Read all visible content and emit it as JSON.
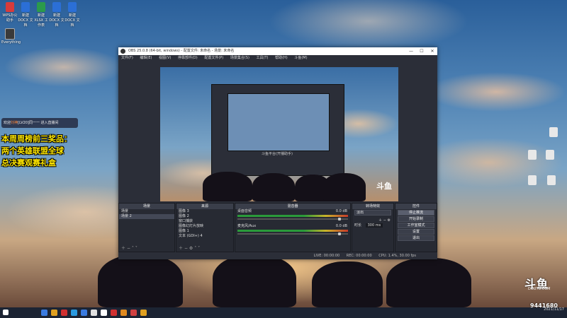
{
  "desktop": {
    "left_icons": [
      {
        "label": "WPS办公助手",
        "color": "#d83b3b"
      },
      {
        "label": "新建 DOCX 文档",
        "color": "#2b6fd6"
      },
      {
        "label": "新建 XLSX 工作表",
        "color": "#2b9a4c"
      },
      {
        "label": "新建 DOCX 文档",
        "color": "#2b6fd6"
      },
      {
        "label": "新建 DOCX 文档",
        "color": "#2b6fd6"
      }
    ],
    "recycle_label": "Everything",
    "right_icons": [
      {
        "label": "",
        "color": "#e8e8e8"
      },
      {
        "label": "",
        "color": "#e8e8e8"
      },
      {
        "label": "",
        "color": "#e8e8e8"
      },
      {
        "label": "",
        "color": "#e8e8e8"
      },
      {
        "label": "",
        "color": "#e8e8e8"
      }
    ],
    "notice_text": "欢迎",
    "notice_user": "刘神",
    "notice_rest": "[LV20]同一一 进入直播间",
    "promo_lines": [
      "本周周榜前三奖品：",
      "两个英雄联盟全球",
      "总决赛观赛礼盒"
    ],
    "brand": "斗鱼",
    "brand_sub": "DOUYU.COM",
    "room_id": "9441680"
  },
  "obs": {
    "title": "OBS 25.0.8 (64-bit, windows) - 配置文件: 未命名 - 场景: 未命名",
    "window_buttons": [
      "—",
      "☐",
      "✕"
    ],
    "menu": [
      "文件(F)",
      "编辑(E)",
      "视图(V)",
      "停靠部件(D)",
      "配置文件(P)",
      "场景集合(S)",
      "工具(T)",
      "帮助(H)",
      "斗鱼(M)"
    ],
    "docks": {
      "scenes": {
        "title": "场景",
        "items": [
          "场景",
          "场景 2"
        ]
      },
      "sources": {
        "title": "来源",
        "items": [
          "图像 3",
          "图像 2",
          "窗口捕获",
          "图像幻灯片放映",
          "图像 1",
          "文本 (GDI+) 4"
        ]
      },
      "mixer": {
        "title": "混音器",
        "channels": [
          {
            "name": "桌面音频",
            "db": "0.0 dB"
          },
          {
            "name": "麦克风/Aux",
            "db": "0.0 dB"
          }
        ]
      },
      "transitions": {
        "title": "转场特效",
        "type": "淡出",
        "duration_label": "时长",
        "duration": "300 ms"
      },
      "controls": {
        "title": "控件",
        "buttons": [
          "停止推流",
          "开始录制",
          "工作室模式",
          "设置",
          "退出"
        ]
      }
    },
    "status": {
      "live": "LIVE: 00:00:00",
      "rec": "REC: 00:00:00",
      "cpu": "CPU: 1.4%, 30.00 fps"
    },
    "nested_label": "斗鱼平台(开播助手)"
  },
  "taskbar": {
    "icons": [
      "#3a7be0",
      "#e0a020",
      "#d03030",
      "#2a9ae0",
      "#3a7be0",
      "#e0e0e0",
      "#ffffff",
      "#d03030",
      "#e08a20",
      "#d04040",
      "#e0a020"
    ],
    "time": "",
    "date": "2021/11/17"
  }
}
